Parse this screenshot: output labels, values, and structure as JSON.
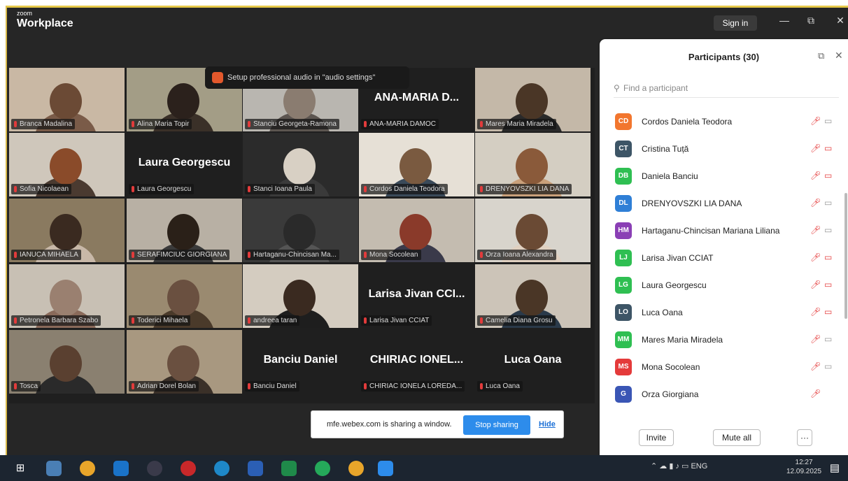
{
  "app": {
    "logo_small": "zoom",
    "logo_big": "Workplace",
    "signin": "Sign in",
    "minimize": "—",
    "restore": "⧉",
    "close": "✕"
  },
  "banner": "Setup professional audio in \"audio settings\"",
  "tiles": [
    {
      "name": "Branca Madalina",
      "big": ""
    },
    {
      "name": "Alina Maria Topir",
      "big": ""
    },
    {
      "name": "Stanciu Georgeta-Ramona",
      "big": ""
    },
    {
      "name": "ANA-MARIA DAMOC",
      "big": "ANA-MARIA D..."
    },
    {
      "name": "Mares Maria Miradela",
      "big": ""
    },
    {
      "name": "Sofia Nicolaean",
      "big": ""
    },
    {
      "name": "Laura Georgescu",
      "big": "Laura Georgescu"
    },
    {
      "name": "Stanci Ioana Paula",
      "big": ""
    },
    {
      "name": "Cordos Daniela Teodora",
      "big": ""
    },
    {
      "name": "DRENYOVSZKI LIA DANA",
      "big": ""
    },
    {
      "name": "IANUCA MIHAELA",
      "big": ""
    },
    {
      "name": "SERAFIMCIUC GIORGIANA",
      "big": ""
    },
    {
      "name": "Hartaganu-Chincisan Ma...",
      "big": ""
    },
    {
      "name": "Mona Socolean",
      "big": ""
    },
    {
      "name": "Orza Ioana Alexandra",
      "big": ""
    },
    {
      "name": "Petronela Barbara Szabo",
      "big": ""
    },
    {
      "name": "Toderici Mihaela",
      "big": ""
    },
    {
      "name": "andreea taran",
      "big": ""
    },
    {
      "name": "Larisa Jivan CCIAT",
      "big": "Larisa Jivan CCI..."
    },
    {
      "name": "Camelia Diana Grosu",
      "big": ""
    },
    {
      "name": "Tosca",
      "big": ""
    },
    {
      "name": "Adrian Dorel Bolan",
      "big": ""
    },
    {
      "name": "Banciu Daniel",
      "big": "Banciu Daniel"
    },
    {
      "name": "CHIRIAC IONELA LOREDA...",
      "big": "CHIRIAC IONEL..."
    },
    {
      "name": "Luca Oana",
      "big": "Luca Oana"
    }
  ],
  "share": {
    "text": "mfe.webex.com is sharing a window.",
    "stop": "Stop sharing",
    "hide": "Hide"
  },
  "panel": {
    "title": "Participants (30)",
    "search_placeholder": "Find a participant",
    "participants": [
      {
        "initials": "CD",
        "name": "Cordos Daniela Teodora",
        "color": "#f2762e"
      },
      {
        "initials": "CT",
        "name": "Cristina Tuță",
        "color": "#3d5566"
      },
      {
        "initials": "DB",
        "name": "Daniela Banciu",
        "color": "#2fbf52"
      },
      {
        "initials": "DL",
        "name": "DRENYOVSZKI LIA DANA",
        "color": "#2f7fd6"
      },
      {
        "initials": "HM",
        "name": "Hartaganu-Chincisan Mariana Liliana",
        "color": "#8a3fb5"
      },
      {
        "initials": "LJ",
        "name": "Larisa Jivan CCIAT",
        "color": "#2fbf52"
      },
      {
        "initials": "LG",
        "name": "Laura Georgescu",
        "color": "#2fbf52"
      },
      {
        "initials": "LO",
        "name": "Luca Oana",
        "color": "#3d5566"
      },
      {
        "initials": "MM",
        "name": "Mares Maria Miradela",
        "color": "#2fbf52"
      },
      {
        "initials": "MS",
        "name": "Mona Socolean",
        "color": "#e43a3a"
      },
      {
        "initials": "G",
        "name": "Orza Giorgiana",
        "color": "#3a56b5"
      }
    ],
    "invite": "Invite",
    "mute_all": "Mute all",
    "more": "···"
  },
  "taskbar": {
    "lang": "ENG",
    "time": "12:27",
    "date": "12.09.2025"
  }
}
